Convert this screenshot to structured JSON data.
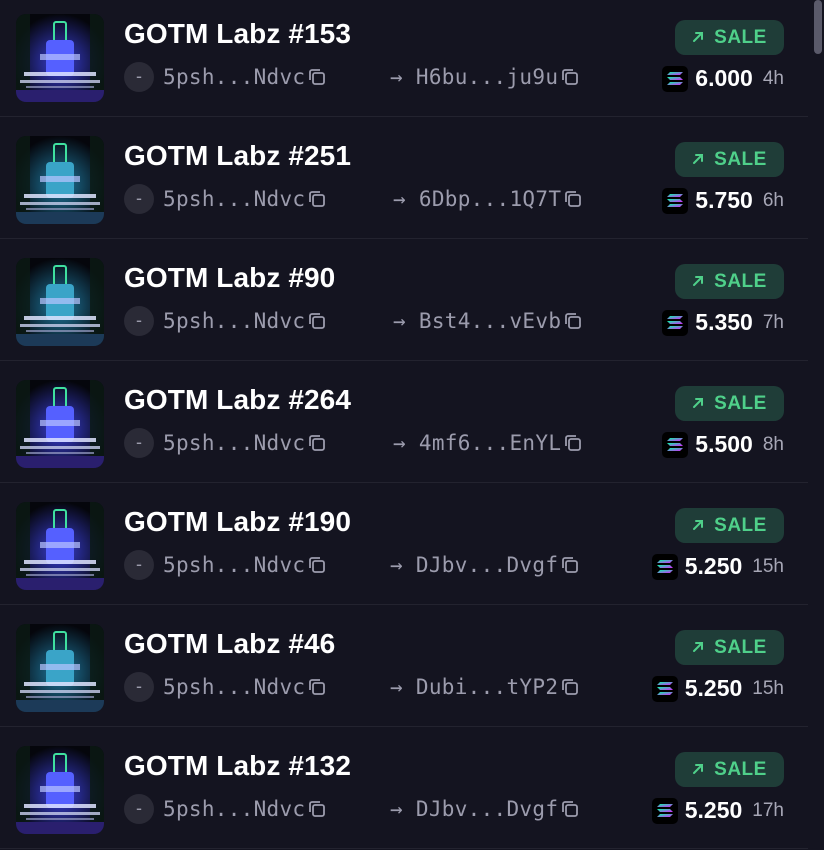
{
  "sale_badge_label": "SALE",
  "accent_sale": "#4fd08a",
  "currency_icon": "solana-icon",
  "items": [
    {
      "name": "GOTM Labz #153",
      "from": "5psh...Ndvc",
      "to": "H6bu...ju9u",
      "price": "6.000",
      "time": "4h",
      "variant": "blue"
    },
    {
      "name": "GOTM Labz #251",
      "from": "5psh...Ndvc",
      "to": "6Dbp...1Q7T",
      "price": "5.750",
      "time": "6h",
      "variant": "teal"
    },
    {
      "name": "GOTM Labz #90",
      "from": "5psh...Ndvc",
      "to": "Bst4...vEvb",
      "price": "5.350",
      "time": "7h",
      "variant": "teal"
    },
    {
      "name": "GOTM Labz #264",
      "from": "5psh...Ndvc",
      "to": "4mf6...EnYL",
      "price": "5.500",
      "time": "8h",
      "variant": "blue"
    },
    {
      "name": "GOTM Labz #190",
      "from": "5psh...Ndvc",
      "to": "DJbv...Dvgf",
      "price": "5.250",
      "time": "15h",
      "variant": "blue"
    },
    {
      "name": "GOTM Labz #46",
      "from": "5psh...Ndvc",
      "to": "Dubi...tYP2",
      "price": "5.250",
      "time": "15h",
      "variant": "teal"
    },
    {
      "name": "GOTM Labz #132",
      "from": "5psh...Ndvc",
      "to": "DJbv...Dvgf",
      "price": "5.250",
      "time": "17h",
      "variant": "blue"
    }
  ]
}
